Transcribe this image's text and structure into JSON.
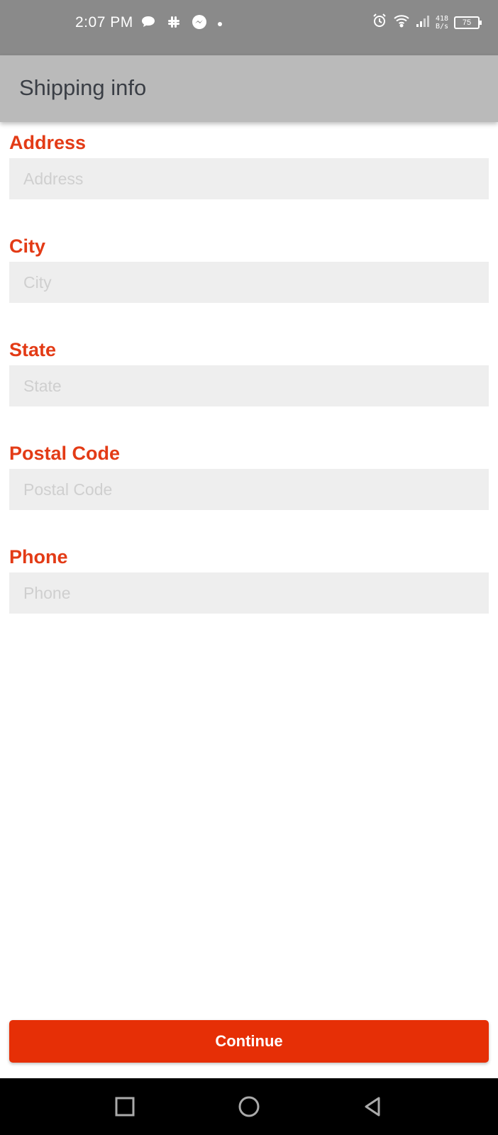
{
  "status_bar": {
    "time": "2:07 PM",
    "network_speed_value": "418",
    "network_speed_unit": "B/s",
    "battery": "75",
    "notification_icons": [
      "chat-bubble-icon",
      "slack-icon",
      "messenger-icon",
      "dot-icon"
    ],
    "system_icons": [
      "alarm-icon",
      "wifi-icon",
      "signal-icon",
      "battery-icon"
    ]
  },
  "app_bar": {
    "title": "Shipping info"
  },
  "form": {
    "fields": [
      {
        "label": "Address",
        "placeholder": "Address",
        "value": ""
      },
      {
        "label": "City",
        "placeholder": "City",
        "value": ""
      },
      {
        "label": "State",
        "placeholder": "State",
        "value": ""
      },
      {
        "label": "Postal Code",
        "placeholder": "Postal Code",
        "value": ""
      },
      {
        "label": "Phone",
        "placeholder": "Phone",
        "value": ""
      }
    ]
  },
  "actions": {
    "continue_label": "Continue"
  },
  "nav_bar": {
    "buttons": [
      "recent-apps-icon",
      "home-icon",
      "back-icon"
    ]
  },
  "colors": {
    "accent": "#e62f06",
    "label": "#e33b16",
    "input_bg": "#eeeeee",
    "app_bar_bg": "#bababa",
    "status_bar_bg": "#8a8a8a"
  }
}
